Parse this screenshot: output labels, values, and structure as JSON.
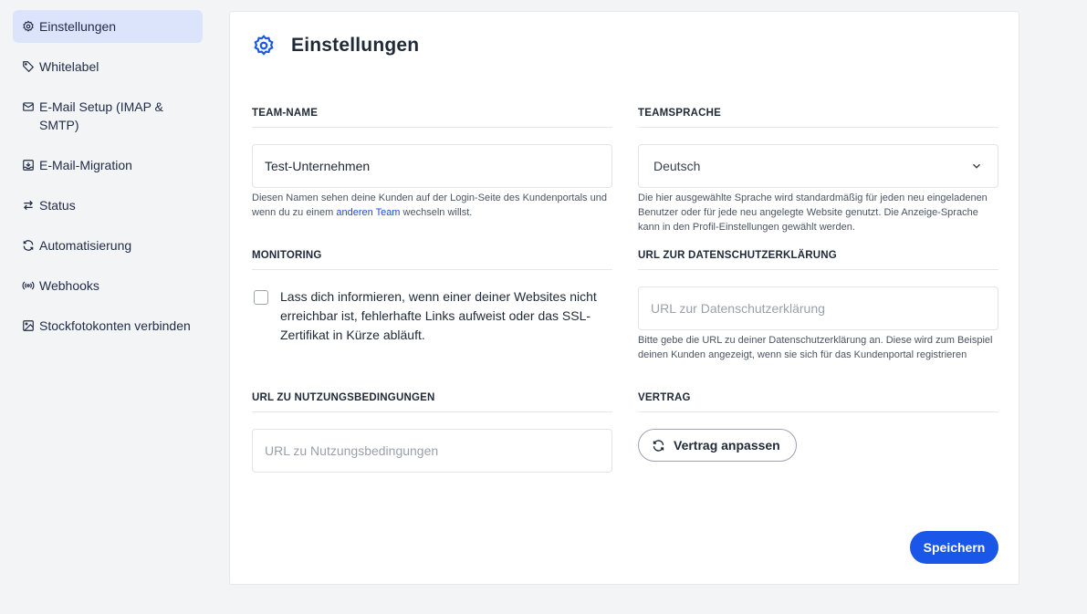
{
  "sidebar": {
    "items": [
      {
        "label": "Einstellungen",
        "icon": "gear-icon",
        "active": true
      },
      {
        "label": "Whitelabel",
        "icon": "tag-icon"
      },
      {
        "label": "E-Mail Setup (IMAP & SMTP)",
        "icon": "mail-icon"
      },
      {
        "label": "E-Mail-Migration",
        "icon": "inbox-download-icon"
      },
      {
        "label": "Status",
        "icon": "arrows-exchange-icon"
      },
      {
        "label": "Automatisierung",
        "icon": "refresh-icon"
      },
      {
        "label": "Webhooks",
        "icon": "webhook-icon"
      },
      {
        "label": "Stockfotokonten verbinden",
        "icon": "image-icon"
      }
    ]
  },
  "page": {
    "title": "Einstellungen",
    "accent_color": "#1a56e8"
  },
  "team_name": {
    "label": "TEAM-NAME",
    "value": "Test-Unternehmen",
    "help_before": "Diesen Namen sehen deine Kunden auf der Login-Seite des Kundenportals und wenn du zu einem ",
    "help_link": "anderen Team",
    "help_after": " wechseln willst."
  },
  "team_language": {
    "label": "TEAMSPRACHE",
    "value": "Deutsch",
    "help": "Die hier ausgewählte Sprache wird standardmäßig für jeden neu eingeladenen Benutzer oder für jede neu angelegte Website genutzt. Die Anzeige-Sprache kann in den Profil-Einstellungen gewählt werden."
  },
  "monitoring": {
    "label": "MONITORING",
    "checkbox_text": "Lass dich informieren, wenn einer deiner Websites nicht erreichbar ist, fehlerhafte Links aufweist oder das SSL-Zertifikat in Kürze abläuft.",
    "checked": false
  },
  "privacy_url": {
    "label": "URL ZUR DATENSCHUTZERKLÄRUNG",
    "placeholder": "URL zur Datenschutzerklärung",
    "help": "Bitte gebe die URL zu deiner Datenschutzerklärung an. Diese wird zum Beispiel deinen Kunden angezeigt, wenn sie sich für das Kundenportal registrieren"
  },
  "terms_url": {
    "label": "URL ZU NUTZUNGSBEDINGUNGEN",
    "placeholder": "URL zu Nutzungsbedingungen"
  },
  "contract": {
    "label": "VERTRAG",
    "button": "Vertrag anpassen"
  },
  "save_button": "Speichern"
}
